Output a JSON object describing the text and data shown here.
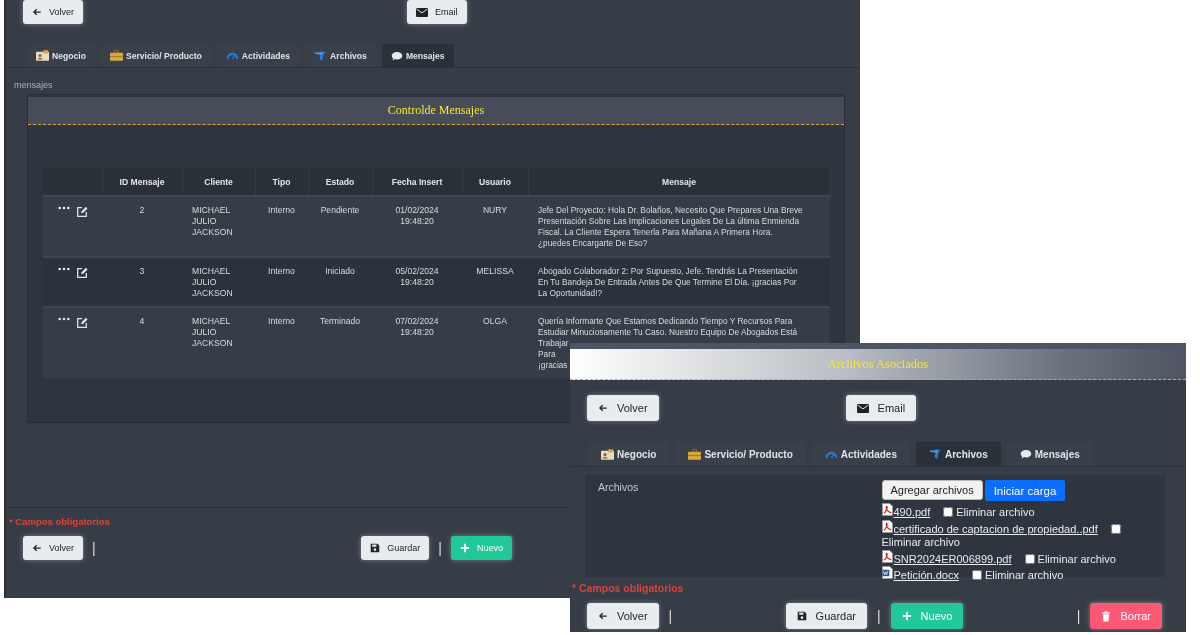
{
  "mensajes_window": {
    "top_buttons": [
      {
        "kind": "back",
        "label": "Volver"
      },
      {
        "kind": "email",
        "label": "Email"
      }
    ],
    "tabs": [
      {
        "kind": "card",
        "label": "Negocio",
        "selected": false
      },
      {
        "kind": "case",
        "label": "Servicio/ Producto",
        "selected": false
      },
      {
        "kind": "gauge",
        "label": "Actividades",
        "selected": false
      },
      {
        "kind": "files",
        "label": "Archivos",
        "selected": false
      },
      {
        "kind": "chat",
        "label": "Mensajes",
        "selected": true
      }
    ],
    "section_label": "mensajes",
    "panel_title": "Controlde Mensajes",
    "table": {
      "columns": [
        "ID Mensaje",
        "Cliente",
        "Tipo",
        "Estado",
        "Fecha Insert",
        "Usuario",
        "Mensaje"
      ],
      "rows": [
        {
          "id": "2",
          "cliente": "MICHAEL JULIO JACKSON",
          "tipo": "Interno",
          "estado": "Pendiente",
          "fecha": "01/02/2024 19:48:20",
          "usuario": "NURY",
          "mensaje_lines": [
            "Jefe Del Proyecto: Hola Dr. Bolaños, Necesito Que Prepares Una Breve",
            "Presentación Sobre Las Implicaciones Legales De La última Enmienda",
            "Fiscal. La Cliente Espera Tenerla Para Mañana A Primera Hora.",
            "¿puedes Encargarte De Eso?"
          ]
        },
        {
          "id": "3",
          "cliente": "MICHAEL JULIO JACKSON",
          "tipo": "Interno",
          "estado": "Iniciado",
          "fecha": "05/02/2024 19:48:20",
          "usuario": "MELISSA",
          "mensaje_lines": [
            "Abogado Colaborador 2: Por Supuesto, Jefe. Tendrás La Presentación",
            "En Tu Bandeja De Entrada Antes De Que Termine El Día. ¡gracias Por",
            "La Oportunidad!?"
          ]
        },
        {
          "id": "4",
          "cliente": "MICHAEL JULIO JACKSON",
          "tipo": "Interno",
          "estado": "Terminado",
          "fecha": "07/02/2024 19:48:20",
          "usuario": "OLGA",
          "mensaje_lines": [
            "Quería Informarte Que Estamos Dedicando Tiempo Y Recursos Para",
            "Estudiar Minuciosamente Tu Caso. Nuestro Equipo De Abogados Está",
            "Trabajar",
            "Para",
            "¡gracias"
          ]
        }
      ]
    },
    "required_note": "* Campos obligatorios",
    "bottom_bar": [
      [
        {
          "kind": "back",
          "label": "Volver"
        },
        {
          "kind": "separator",
          "label": "|"
        }
      ],
      [
        {
          "kind": "save",
          "label": "Guardar"
        },
        {
          "kind": "separator",
          "label": "|"
        },
        {
          "kind": "new",
          "label": "Nuevo"
        }
      ]
    ]
  },
  "archivos_window": {
    "title": "Archivos Asociados",
    "top_buttons": [
      {
        "kind": "back",
        "label": "Volver"
      },
      {
        "kind": "email",
        "label": "Email"
      }
    ],
    "tabs": [
      {
        "kind": "card",
        "label": "Negocio",
        "selected": false
      },
      {
        "kind": "case",
        "label": "Servicio/ Producto",
        "selected": false
      },
      {
        "kind": "gauge",
        "label": "Actividades",
        "selected": false
      },
      {
        "kind": "files",
        "label": "Archivos",
        "selected": true
      },
      {
        "kind": "chat",
        "label": "Mensajes",
        "selected": false
      }
    ],
    "field_label": "Archivos",
    "actions": [
      {
        "kind": "add",
        "label": "Agregar archivos"
      },
      {
        "kind": "upload",
        "label": "Iniciar carga"
      }
    ],
    "files": [
      {
        "kind": "pdf",
        "name": "490.pdf",
        "delete_label": "Eliminar archivo",
        "checked": false
      },
      {
        "kind": "pdf",
        "name": "certificado de captacion de propiedad..pdf",
        "delete_label": "Eliminar archivo",
        "checked": false
      },
      {
        "kind": "pdf",
        "name": "SNR2024ER006899.pdf",
        "delete_label": "Eliminar archivo",
        "checked": false
      },
      {
        "kind": "docx",
        "name": "Petición.docx",
        "delete_label": "Eliminar archivo",
        "checked": false
      }
    ],
    "required_note": "* Campos obligatorios",
    "bottom_bar": [
      [
        {
          "kind": "back",
          "label": "Volver"
        },
        {
          "kind": "separator",
          "label": "|"
        }
      ],
      [
        {
          "kind": "save",
          "label": "Guardar"
        },
        {
          "kind": "separator",
          "label": "|"
        },
        {
          "kind": "new",
          "label": "Nuevo"
        }
      ],
      [
        {
          "kind": "separator",
          "label": "|"
        },
        {
          "kind": "delete",
          "label": "Borrar"
        }
      ]
    ]
  }
}
